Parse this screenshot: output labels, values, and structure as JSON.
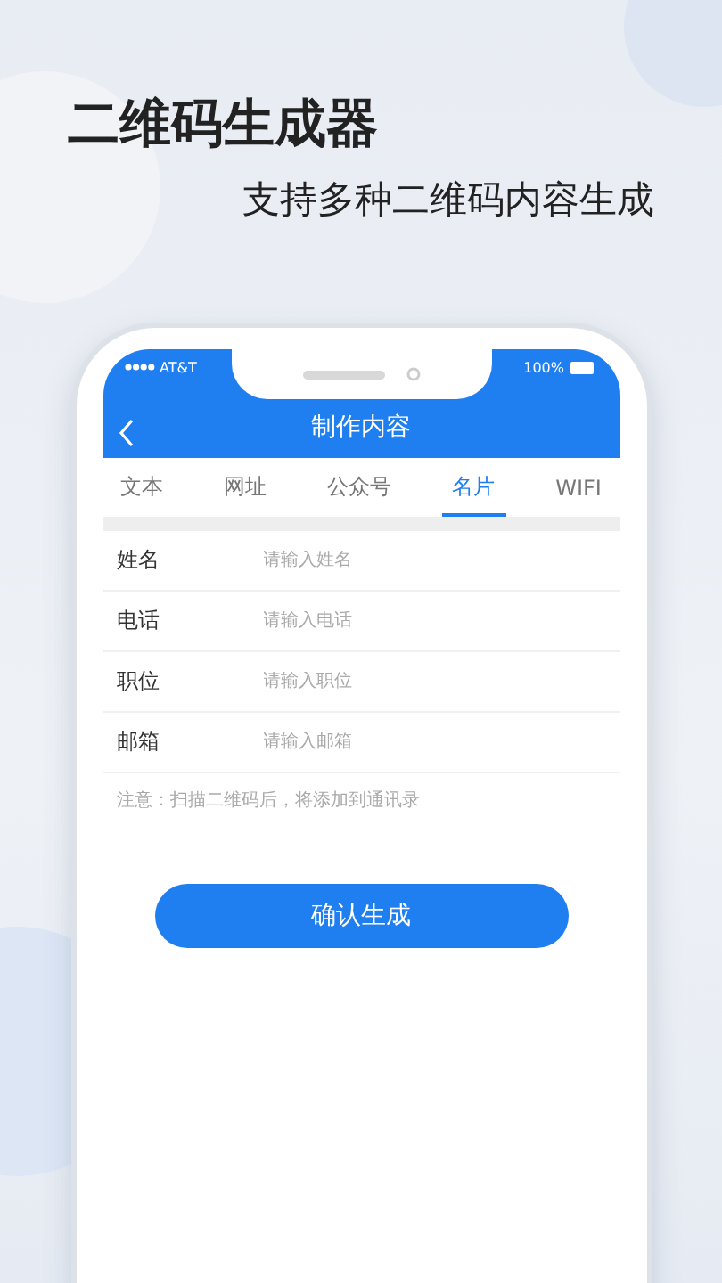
{
  "headline": {
    "title": "二维码生成器",
    "subtitle": "支持多种二维码内容生成"
  },
  "status_bar": {
    "carrier": "AT&T",
    "battery": "100%"
  },
  "nav_bar": {
    "title": "制作内容"
  },
  "tabs": [
    {
      "label": "文本",
      "selected": false
    },
    {
      "label": "网址",
      "selected": false
    },
    {
      "label": "公众号",
      "selected": false
    },
    {
      "label": "名片",
      "selected": true
    },
    {
      "label": "WIFI",
      "selected": false
    }
  ],
  "form": {
    "fields": [
      {
        "label": "姓名",
        "placeholder": "请输入姓名"
      },
      {
        "label": "电话",
        "placeholder": "请输入电话"
      },
      {
        "label": "职位",
        "placeholder": "请输入职位"
      },
      {
        "label": "邮箱",
        "placeholder": "请输入邮箱"
      }
    ],
    "note": "注意：扫描二维码后，将添加到通讯录"
  },
  "submit_button": "确认生成"
}
